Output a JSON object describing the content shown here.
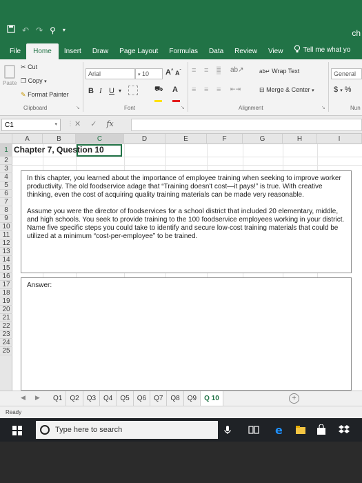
{
  "title_bar": {
    "doc_title": "ch"
  },
  "tabs": [
    "File",
    "Home",
    "Insert",
    "Draw",
    "Page Layout",
    "Formulas",
    "Data",
    "Review",
    "View"
  ],
  "tell_me": "Tell me what yo",
  "ribbon": {
    "cut": "Cut",
    "copy": "Copy",
    "paste": "Paste",
    "format_painter": "Format Painter",
    "font_name": "Arial",
    "font_size": "10",
    "wrap_text": "Wrap Text",
    "merge_center": "Merge & Center",
    "number_format": "General",
    "currency": "$",
    "percent": "%",
    "groups": {
      "clipboard": "Clipboard",
      "font": "Font",
      "alignment": "Alignment",
      "number": "Nun"
    }
  },
  "formula_bar": {
    "name_box": "C1",
    "fx": "fx",
    "value": ""
  },
  "columns": [
    "A",
    "B",
    "C",
    "D",
    "E",
    "F",
    "G",
    "H",
    "I"
  ],
  "rows": [
    "1",
    "2",
    "3",
    "4",
    "5",
    "6",
    "7",
    "8",
    "9",
    "10",
    "11",
    "12",
    "13",
    "14",
    "15",
    "16",
    "17",
    "18",
    "19",
    "20",
    "21",
    "22",
    "23",
    "24",
    "25"
  ],
  "sheet": {
    "title": "Chapter 7, Question 10",
    "question_p1": "In this chapter, you learned about the importance of employee training when seeking to improve worker productivity. The old foodservice adage that “Training doesn't cost—it pays!” is true. With creative thinking, even the cost of acquiring quality training materials can be made very reasonable.",
    "question_p2": "Assume you were the director of foodservices for a school district that included 20 elementary, middle, and high schools. You seek to provide training to the 100 foodservice employees working in your district. Name five specific steps you could take to identify and secure low-cost training materials that could be utilized at a minimum “cost-per-employee” to be trained.",
    "answer_label": "Answer:"
  },
  "sheet_tabs": [
    "Q1",
    "Q2",
    "Q3",
    "Q4",
    "Q5",
    "Q6",
    "Q7",
    "Q8",
    "Q9",
    "Q 10"
  ],
  "active_sheet": "Q 10",
  "status": "Ready",
  "taskbar": {
    "search_placeholder": "Type here to search"
  },
  "colors": {
    "excel_green": "#217346",
    "taskbar": "#1f2226"
  }
}
